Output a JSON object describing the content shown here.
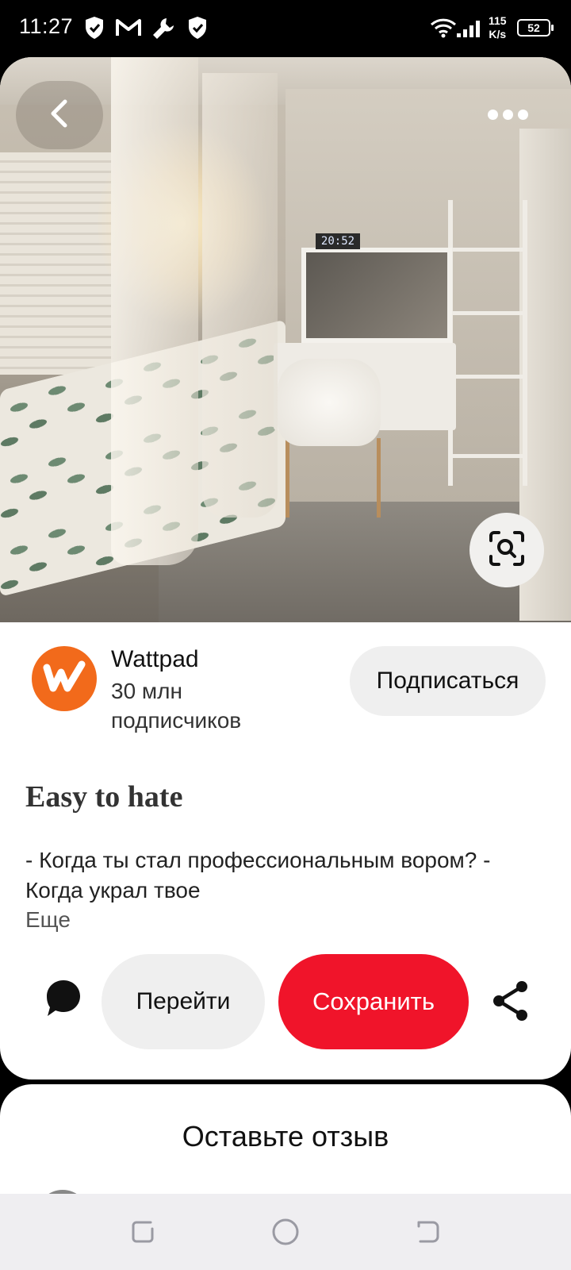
{
  "status_bar": {
    "time": "11:27",
    "speed_value": "115",
    "speed_unit": "K/s",
    "battery": "52"
  },
  "photo": {
    "clock_text": "20:52"
  },
  "creator": {
    "name": "Wattpad",
    "followers": "30 млн подписчиков",
    "follow_label": "Подписаться"
  },
  "pin": {
    "title": "Easy to hate",
    "description": "- Когда ты стал профессиональным вором? - Когда украл твое",
    "more_label": "Еще"
  },
  "actions": {
    "visit_label": "Перейти",
    "save_label": "Сохранить"
  },
  "review": {
    "title": "Оставьте отзыв"
  },
  "colors": {
    "save_red": "#f0142a",
    "wattpad_orange": "#f26a1b",
    "pill_gray": "#efefef"
  },
  "icons": [
    "back-arrow-icon",
    "more-dots-icon",
    "visual-search-icon",
    "comment-icon",
    "share-icon",
    "nav-recents-icon",
    "nav-home-icon",
    "nav-back-icon"
  ]
}
